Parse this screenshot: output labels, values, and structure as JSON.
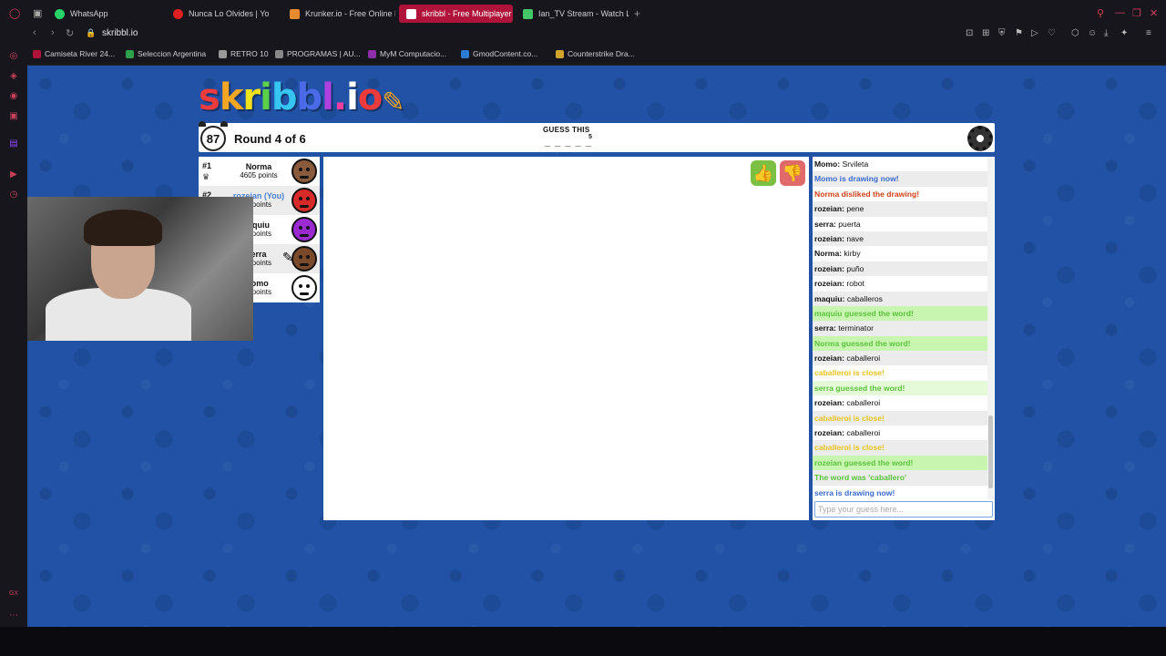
{
  "browser": {
    "tabs": [
      {
        "label": "WhatsApp",
        "color": "#25d366"
      },
      {
        "label": "Nunca Lo Olvides | Yo",
        "color": "#e02020"
      },
      {
        "label": "Krunker.io - Free Online M",
        "color": "#e68a2e"
      },
      {
        "label": "skribbl - Free Multiplayer",
        "color": "#5b7bd6"
      },
      {
        "label": "Ian_TV Stream - Watch Liv",
        "color": "#44c767"
      }
    ],
    "url": "skribbl.io",
    "bookmarks": [
      {
        "label": "Camiseta River 24...",
        "color": "#b0133a"
      },
      {
        "label": "Seleccion Argentina",
        "color": "#2e9f4b"
      },
      {
        "label": "RETRO 10",
        "color": "#999999"
      },
      {
        "label": "PROGRAMAS | AU...",
        "color": "#888888"
      },
      {
        "label": "MyM Computacio...",
        "color": "#8c2ea8"
      },
      {
        "label": "GmodContent.co...",
        "color": "#2a7bd1"
      },
      {
        "label": "Counterstrike Dra...",
        "color": "#d1a52a"
      }
    ]
  },
  "game": {
    "logo": "skribbl.io",
    "timer": "87",
    "round": "Round 4 of 6",
    "guess_label": "GUESS THIS",
    "word_blanks": "_ _ _ _ _",
    "word_length": "5",
    "players": [
      {
        "rank": "#1",
        "name": "Norma",
        "points": "4605 points",
        "avatar_color": "#8a5a3c",
        "you": false
      },
      {
        "rank": "#2",
        "name": "rozeian (You)",
        "points": "5 points",
        "avatar_color": "#d92a2a",
        "you": true
      },
      {
        "rank": "",
        "name": "aquiu",
        "points": "0 points",
        "avatar_color": "#9b2ad1",
        "you": false
      },
      {
        "rank": "",
        "name": "erra",
        "points": "0 points",
        "avatar_color": "#7a4a2a",
        "you": false
      },
      {
        "rank": "",
        "name": "lomo",
        "points": "0 points",
        "avatar_color": "#ffffff",
        "you": false
      }
    ]
  },
  "chat": {
    "messages": [
      {
        "author": "Momo:",
        "text": "Srvileta",
        "style": "normal"
      },
      {
        "author": "",
        "text": "Momo is drawing now!",
        "style": "blue"
      },
      {
        "author": "",
        "text": "Norma disliked the drawing!",
        "style": "red"
      },
      {
        "author": "rozeian:",
        "text": "pene",
        "style": "normal"
      },
      {
        "author": "serra:",
        "text": "puerta",
        "style": "normal"
      },
      {
        "author": "rozeian:",
        "text": "nave",
        "style": "normal"
      },
      {
        "author": "Norma:",
        "text": "kirby",
        "style": "normal"
      },
      {
        "author": "rozeian:",
        "text": "puño",
        "style": "normal"
      },
      {
        "author": "rozeian:",
        "text": "robot",
        "style": "normal"
      },
      {
        "author": "maquiu:",
        "text": "caballeros",
        "style": "normal"
      },
      {
        "author": "",
        "text": "maquiu guessed the word!",
        "style": "green"
      },
      {
        "author": "serra:",
        "text": "terminator",
        "style": "normal"
      },
      {
        "author": "",
        "text": "Norma guessed the word!",
        "style": "green"
      },
      {
        "author": "rozeian:",
        "text": "caballeroi",
        "style": "normal"
      },
      {
        "author": "",
        "text": "caballeroi is close!",
        "style": "yellow"
      },
      {
        "author": "",
        "text": "serra guessed the word!",
        "style": "greenalt"
      },
      {
        "author": "rozeian:",
        "text": "caballeroi",
        "style": "normal"
      },
      {
        "author": "",
        "text": "caballeroi is close!",
        "style": "yellow"
      },
      {
        "author": "rozeian:",
        "text": "caballeroi",
        "style": "normal"
      },
      {
        "author": "",
        "text": "caballeroi is close!",
        "style": "yellow"
      },
      {
        "author": "",
        "text": "rozeian guessed the word!",
        "style": "green"
      },
      {
        "author": "",
        "text": "The word was 'caballero'",
        "style": "greentext"
      },
      {
        "author": "",
        "text": "serra is drawing now!",
        "style": "blue"
      }
    ],
    "input_placeholder": "Type your guess here..."
  }
}
